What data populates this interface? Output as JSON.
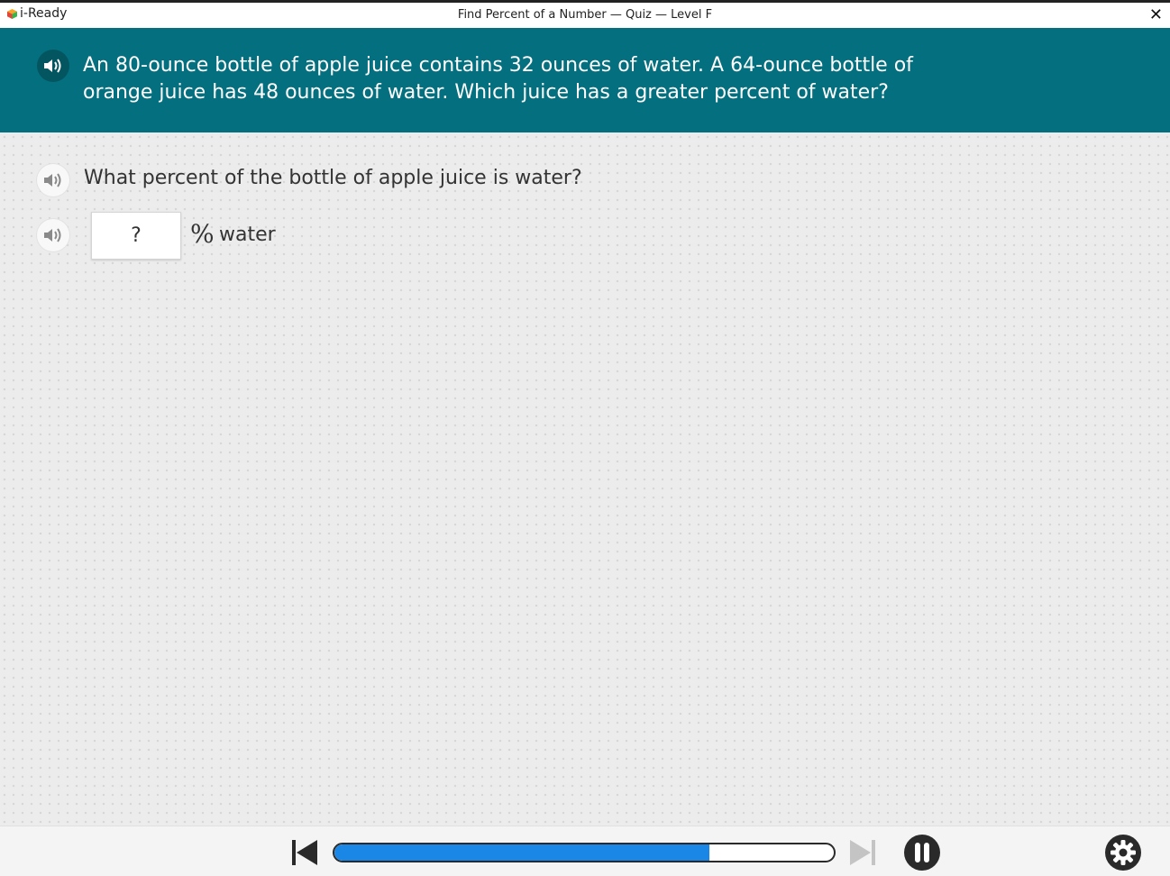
{
  "titlebar": {
    "logo_text": "i-Ready",
    "window_title": "Find Percent of a Number — Quiz — Level F",
    "close_glyph": "✕"
  },
  "prompt": {
    "text": "An 80-ounce bottle of apple juice contains 32 ounces of water. A 64-ounce bottle of orange juice has 48 ounces of water. Which juice has a greater percent of water?",
    "speaker_icon": "speaker-icon"
  },
  "question": {
    "text": "What percent of the bottle of apple juice is water?",
    "answer_value": "?",
    "percent_symbol": "%",
    "unit_label": "water"
  },
  "player": {
    "progress_fraction": 0.75,
    "icons": [
      "skip-back-icon",
      "skip-forward-icon",
      "pause-icon",
      "settings-gear-icon"
    ]
  },
  "colors": {
    "prompt_bg": "#046f7e",
    "progress_fill": "#1a86e6",
    "page_bg": "#ececec"
  }
}
